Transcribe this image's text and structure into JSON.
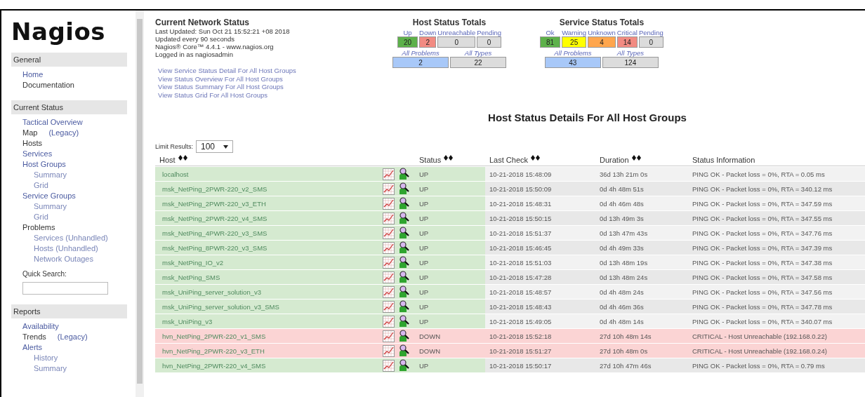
{
  "sidebar": {
    "logo": "Nagios",
    "sections": [
      {
        "title": "General",
        "items": [
          {
            "label": "Home",
            "link": true
          },
          {
            "label": "Documentation",
            "link": false
          }
        ]
      },
      {
        "title": "Current Status",
        "items": [
          {
            "label": "Tactical Overview",
            "link": true
          },
          {
            "label": "Map",
            "note": "(Legacy)",
            "link": false
          },
          {
            "label": "Hosts",
            "link": false
          },
          {
            "label": "Services",
            "link": true
          },
          {
            "label": "Host Groups",
            "link": true,
            "children": [
              {
                "label": "Summary"
              },
              {
                "label": "Grid"
              }
            ]
          },
          {
            "label": "Service Groups",
            "link": true,
            "children": [
              {
                "label": "Summary"
              },
              {
                "label": "Grid"
              }
            ]
          },
          {
            "label": "Problems",
            "link": false,
            "children": [
              {
                "label": "Services (Unhandled)"
              },
              {
                "label": "Hosts (Unhandled)"
              },
              {
                "label": "Network Outages"
              }
            ]
          }
        ],
        "search": {
          "label": "Quick Search:"
        }
      },
      {
        "title": "Reports",
        "items": [
          {
            "label": "Availability",
            "link": true
          },
          {
            "label": "Trends",
            "note": "(Legacy)",
            "link": false
          },
          {
            "label": "Alerts",
            "link": true,
            "children": [
              {
                "label": "History"
              },
              {
                "label": "Summary"
              }
            ]
          }
        ]
      }
    ]
  },
  "status": {
    "title": "Current Network Status",
    "lines": [
      "Last Updated: Sun Oct 21 15:52:21 +08 2018",
      "Updated every 90 seconds",
      "Nagios® Core™ 4.4.1 - www.nagios.org",
      "Logged in as nagiosadmin"
    ],
    "links": [
      "View Service Status Detail For All Host Groups",
      "View Status Overview For All Host Groups",
      "View Status Summary For All Host Groups",
      "View Status Grid For All Host Groups"
    ]
  },
  "host_totals": {
    "title": "Host Status Totals",
    "cells": [
      {
        "label": "Up",
        "value": "20",
        "color": "#5db14a"
      },
      {
        "label": "Down",
        "value": "2",
        "color": "#f28b82"
      },
      {
        "label": "Unreachable",
        "value": "0",
        "color": "#dcdcdc"
      },
      {
        "label": "Pending",
        "value": "0",
        "color": "#dcdcdc"
      }
    ],
    "summary": [
      {
        "label": "All Problems",
        "value": "2",
        "color": "#a8c8f8"
      },
      {
        "label": "All Types",
        "value": "22",
        "color": "#dcdcdc"
      }
    ]
  },
  "service_totals": {
    "title": "Service Status Totals",
    "cells": [
      {
        "label": "Ok",
        "value": "81",
        "color": "#5db14a"
      },
      {
        "label": "Warning",
        "value": "25",
        "color": "#ffff00"
      },
      {
        "label": "Unknown",
        "value": "4",
        "color": "#ffa64d"
      },
      {
        "label": "Critical",
        "value": "14",
        "color": "#f28b82"
      },
      {
        "label": "Pending",
        "value": "0",
        "color": "#dcdcdc"
      }
    ],
    "summary": [
      {
        "label": "All Problems",
        "value": "43",
        "color": "#a8c8f8"
      },
      {
        "label": "All Types",
        "value": "124",
        "color": "#dcdcdc"
      }
    ]
  },
  "heading": "Host Status Details For All Host Groups",
  "limit": {
    "label": "Limit Results:",
    "value": "100"
  },
  "table": {
    "columns": [
      "Host",
      "Status",
      "Last Check",
      "Duration",
      "Status Information"
    ],
    "rows": [
      {
        "host": "localhost",
        "status": "UP",
        "kind": "up",
        "last_check": "10-21-2018 15:48:09",
        "duration": "36d 13h 21m 0s",
        "info": "PING OK - Packet loss = 0%, RTA = 0.05 ms"
      },
      {
        "host": "msk_NetPing_2PWR-220_v2_SMS",
        "status": "UP",
        "kind": "up",
        "last_check": "10-21-2018 15:50:09",
        "duration": "0d 4h 48m 51s",
        "info": "PING OK - Packet loss = 0%, RTA = 340.12 ms"
      },
      {
        "host": "msk_NetPing_2PWR-220_v3_ETH",
        "status": "UP",
        "kind": "up",
        "last_check": "10-21-2018 15:48:31",
        "duration": "0d 4h 46m 48s",
        "info": "PING OK - Packet loss = 0%, RTA = 347.59 ms"
      },
      {
        "host": "msk_NetPing_2PWR-220_v4_SMS",
        "status": "UP",
        "kind": "up",
        "last_check": "10-21-2018 15:50:15",
        "duration": "0d 13h 49m 3s",
        "info": "PING OK - Packet loss = 0%, RTA = 347.55 ms"
      },
      {
        "host": "msk_NetPing_4PWR-220_v3_SMS",
        "status": "UP",
        "kind": "up",
        "last_check": "10-21-2018 15:51:37",
        "duration": "0d 13h 47m 43s",
        "info": "PING OK - Packet loss = 0%, RTA = 347.76 ms"
      },
      {
        "host": "msk_NetPing_8PWR-220_v3_SMS",
        "status": "UP",
        "kind": "up",
        "last_check": "10-21-2018 15:46:45",
        "duration": "0d 4h 49m 33s",
        "info": "PING OK - Packet loss = 0%, RTA = 347.39 ms"
      },
      {
        "host": "msk_NetPing_IO_v2",
        "status": "UP",
        "kind": "up",
        "last_check": "10-21-2018 15:51:03",
        "duration": "0d 13h 48m 19s",
        "info": "PING OK - Packet loss = 0%, RTA = 347.38 ms"
      },
      {
        "host": "msk_NetPing_SMS",
        "status": "UP",
        "kind": "up",
        "last_check": "10-21-2018 15:47:28",
        "duration": "0d 13h 48m 24s",
        "info": "PING OK - Packet loss = 0%, RTA = 347.58 ms"
      },
      {
        "host": "msk_UniPing_server_solution_v3",
        "status": "UP",
        "kind": "up",
        "last_check": "10-21-2018 15:48:57",
        "duration": "0d 4h 48m 24s",
        "info": "PING OK - Packet loss = 0%, RTA = 347.56 ms"
      },
      {
        "host": "msk_UniPing_server_solution_v3_SMS",
        "status": "UP",
        "kind": "up",
        "last_check": "10-21-2018 15:48:43",
        "duration": "0d 4h 46m 36s",
        "info": "PING OK - Packet loss = 0%, RTA = 347.78 ms"
      },
      {
        "host": "msk_UniPing_v3",
        "status": "UP",
        "kind": "up",
        "last_check": "10-21-2018 15:49:05",
        "duration": "0d 4h 48m 14s",
        "info": "PING OK - Packet loss = 0%, RTA = 340.07 ms"
      },
      {
        "host": "hvn_NetPing_2PWR-220_v1_SMS",
        "status": "DOWN",
        "kind": "down",
        "last_check": "10-21-2018 15:52:18",
        "duration": "27d 10h 48m 14s",
        "info": "CRITICAL - Host Unreachable (192.168.0.22)"
      },
      {
        "host": "hvn_NetPing_2PWR-220_v3_ETH",
        "status": "DOWN",
        "kind": "down",
        "last_check": "10-21-2018 15:51:27",
        "duration": "27d 10h 48m 0s",
        "info": "CRITICAL - Host Unreachable (192.168.0.24)"
      },
      {
        "host": "hvn_NetPing_2PWR-220_v4_SMS",
        "status": "UP",
        "kind": "up",
        "last_check": "10-21-2018 15:50:17",
        "duration": "27d 10h 47m 46s",
        "info": "PING OK - Packet loss = 0%, RTA = 0.79 ms"
      }
    ]
  }
}
